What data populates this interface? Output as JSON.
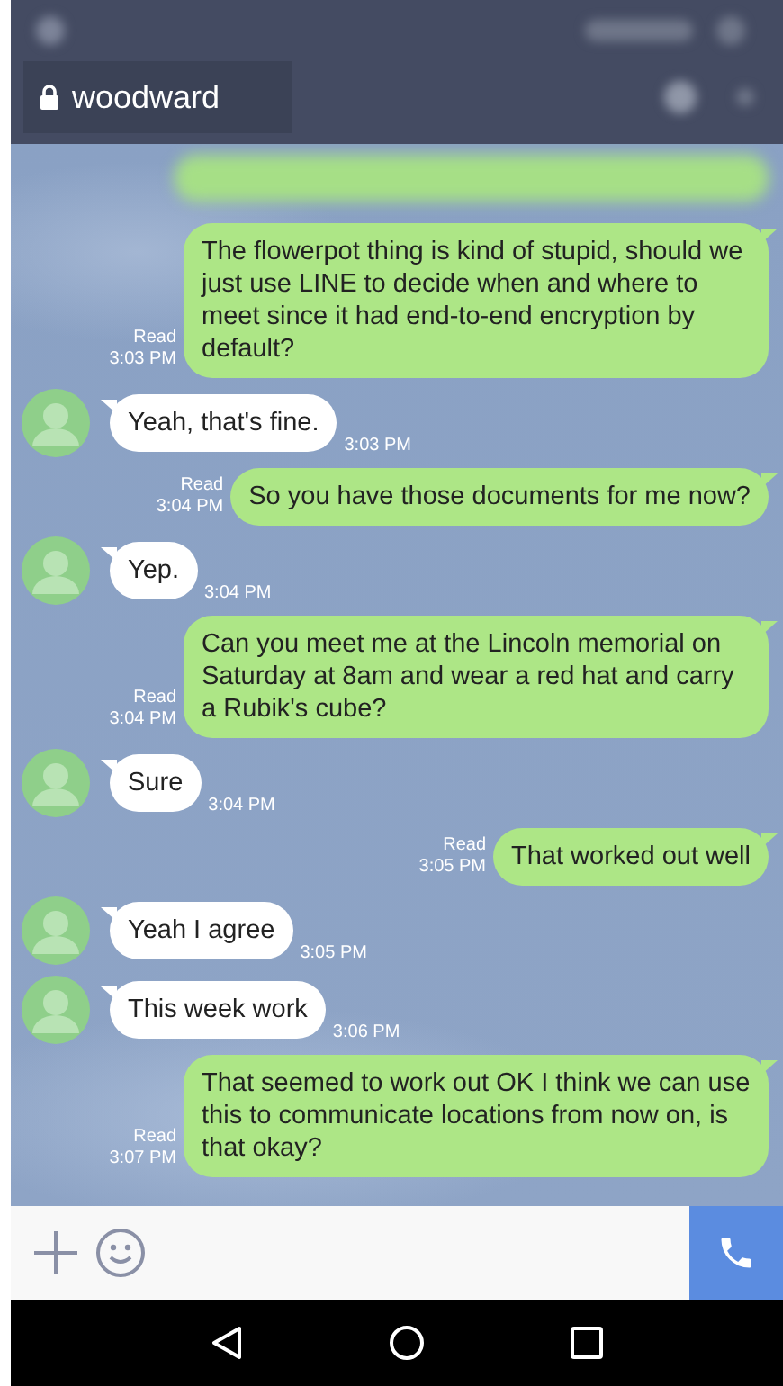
{
  "header": {
    "title": "woodward",
    "locked": true
  },
  "messages": [
    {
      "kind": "out",
      "text": "The flowerpot thing is kind of stupid, should we just use LINE to decide when and where to meet since it had end-to-end encryption by default?",
      "status": "Read",
      "time": "3:03 PM"
    },
    {
      "kind": "in",
      "text": "Yeah, that's fine.",
      "time": "3:03 PM"
    },
    {
      "kind": "out",
      "text": "So you have those documents for me now?",
      "status": "Read",
      "time": "3:04 PM"
    },
    {
      "kind": "in",
      "text": "Yep.",
      "time": "3:04 PM"
    },
    {
      "kind": "out",
      "text": "Can you meet me at the Lincoln memorial on Saturday at 8am and wear a red hat and carry a Rubik's cube?",
      "status": "Read",
      "time": "3:04 PM"
    },
    {
      "kind": "in",
      "text": "Sure",
      "time": "3:04 PM"
    },
    {
      "kind": "out",
      "text": "That worked out well",
      "status": "Read",
      "time": "3:05 PM"
    },
    {
      "kind": "in",
      "text": "Yeah I agree",
      "time": "3:05 PM"
    },
    {
      "kind": "in",
      "text": "This week work",
      "time": "3:06 PM"
    },
    {
      "kind": "out",
      "text": "That seemed to work out OK I think we can use this to communicate locations from now on, is that okay?",
      "status": "Read",
      "time": "3:07 PM"
    }
  ]
}
